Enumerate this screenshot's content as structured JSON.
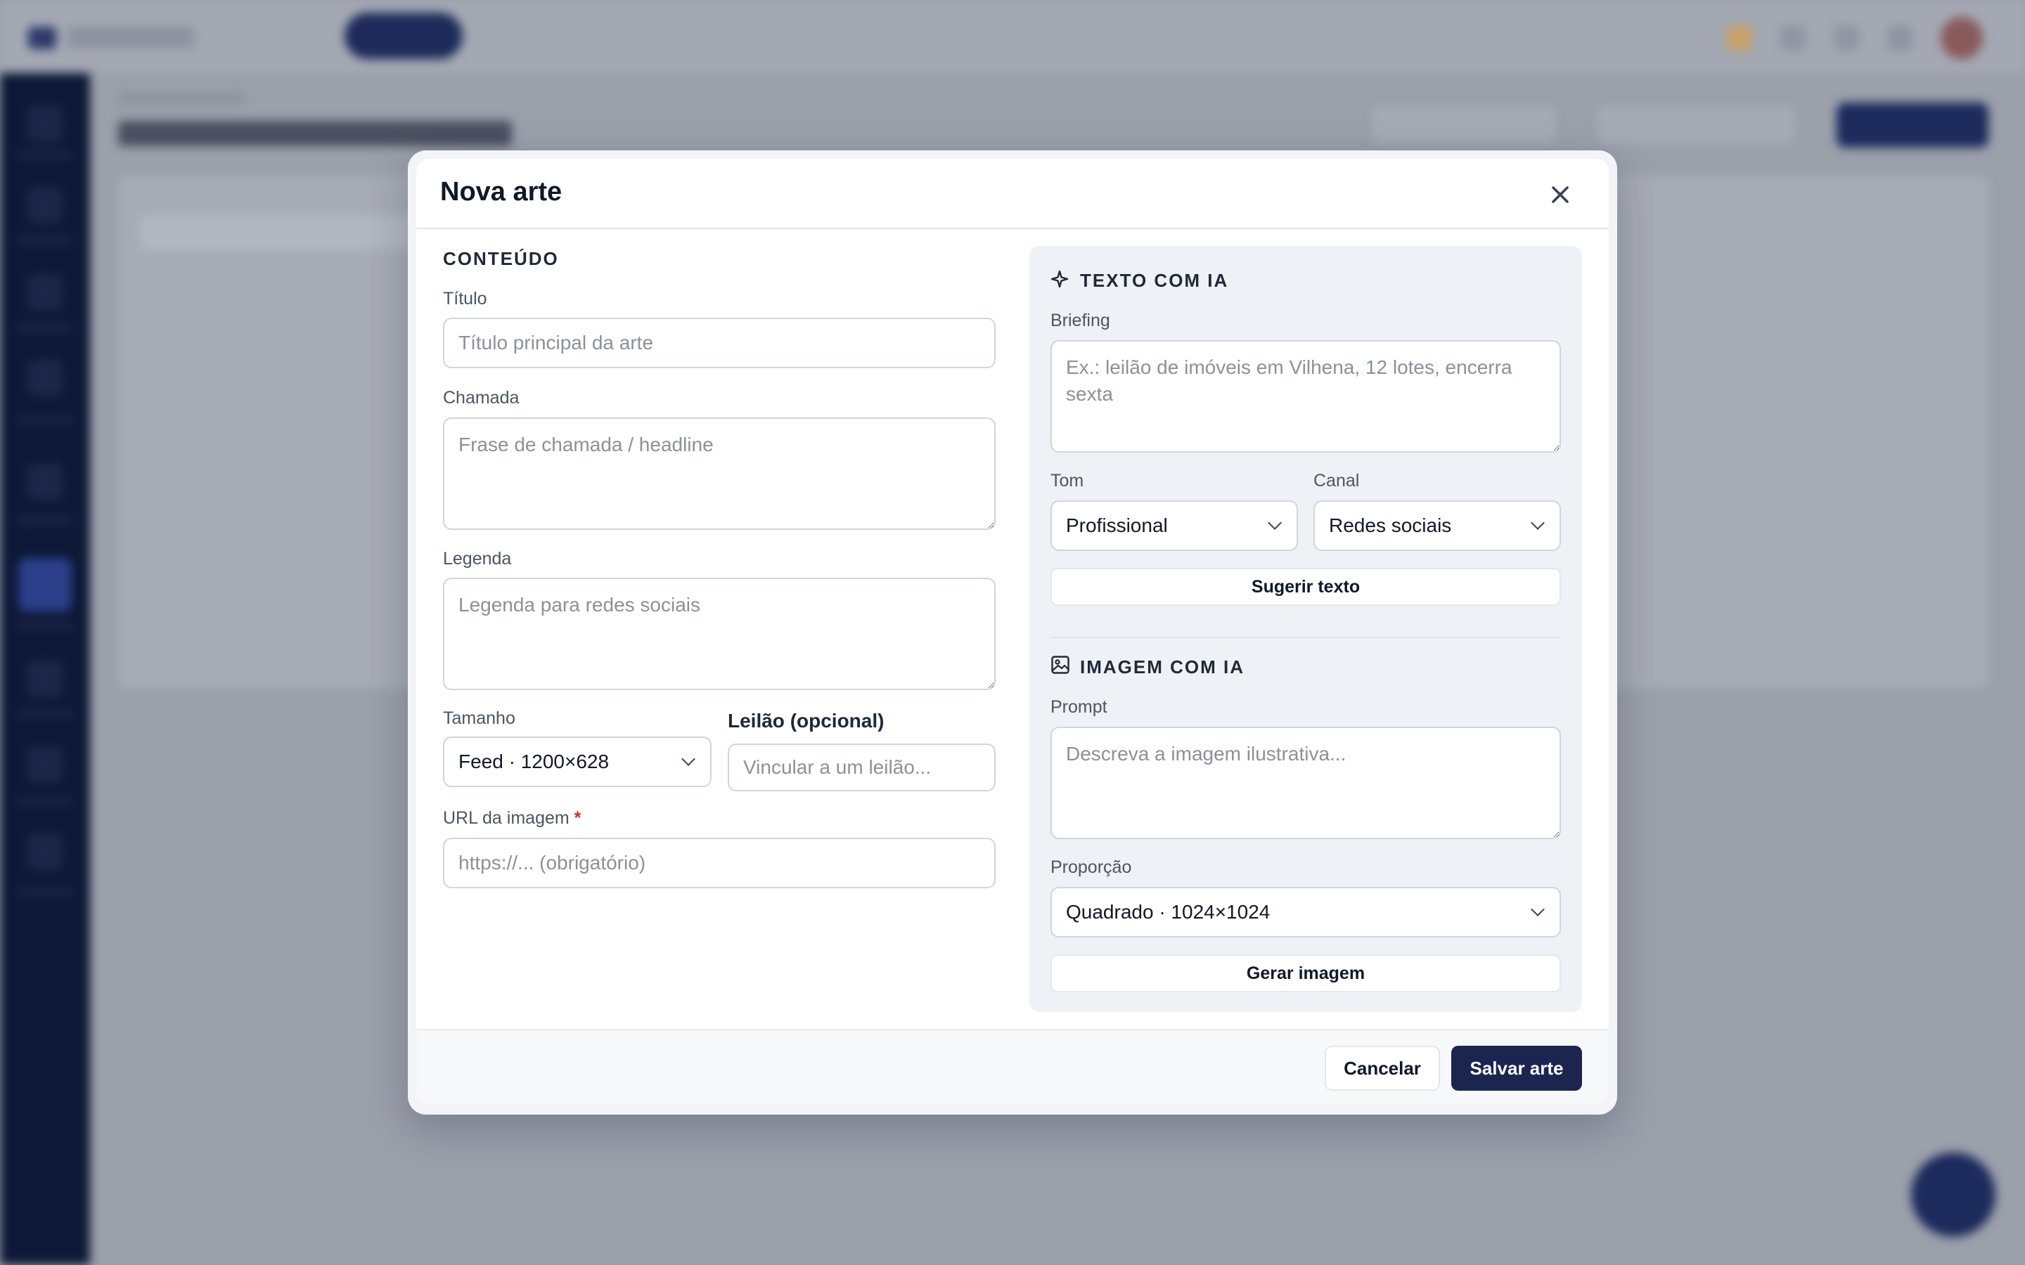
{
  "background": {
    "note_blurred": true
  },
  "modal": {
    "title": "Nova arte",
    "close_icon": "close-icon",
    "content": {
      "section_title": "CONTEÚDO",
      "title_label": "Título",
      "title_placeholder": "Título principal da arte",
      "headline_label": "Chamada",
      "headline_placeholder": "Frase de chamada / headline",
      "caption_label": "Legenda",
      "caption_placeholder": "Legenda para redes sociais",
      "size_label": "Tamanho",
      "size_value": "Feed · 1200×628",
      "auction_label": "Leilão (opcional)",
      "auction_placeholder": "Vincular a um leilão...",
      "image_url_label": "URL da imagem",
      "image_url_required": "*",
      "image_url_placeholder": "https://... (obrigatório)"
    },
    "ai_text": {
      "icon": "sparkle-icon",
      "section_title": "TEXTO COM IA",
      "briefing_label": "Briefing",
      "briefing_placeholder": "Ex.: leilão de imóveis em Vilhena, 12 lotes, encerra sexta",
      "tone_label": "Tom",
      "tone_value": "Profissional",
      "channel_label": "Canal",
      "channel_value": "Redes sociais",
      "suggest_button": "Sugerir texto"
    },
    "ai_image": {
      "icon": "image-icon",
      "section_title": "IMAGEM COM IA",
      "prompt_label": "Prompt",
      "prompt_placeholder": "Descreva a imagem ilustrativa...",
      "ratio_label": "Proporção",
      "ratio_value": "Quadrado · 1024×1024",
      "generate_button": "Gerar imagem"
    },
    "footer": {
      "cancel_button": "Cancelar",
      "save_button": "Salvar arte"
    }
  },
  "colors": {
    "primary": "#1b2550",
    "required": "#dc2626",
    "overlay": "#9ba0ab"
  }
}
